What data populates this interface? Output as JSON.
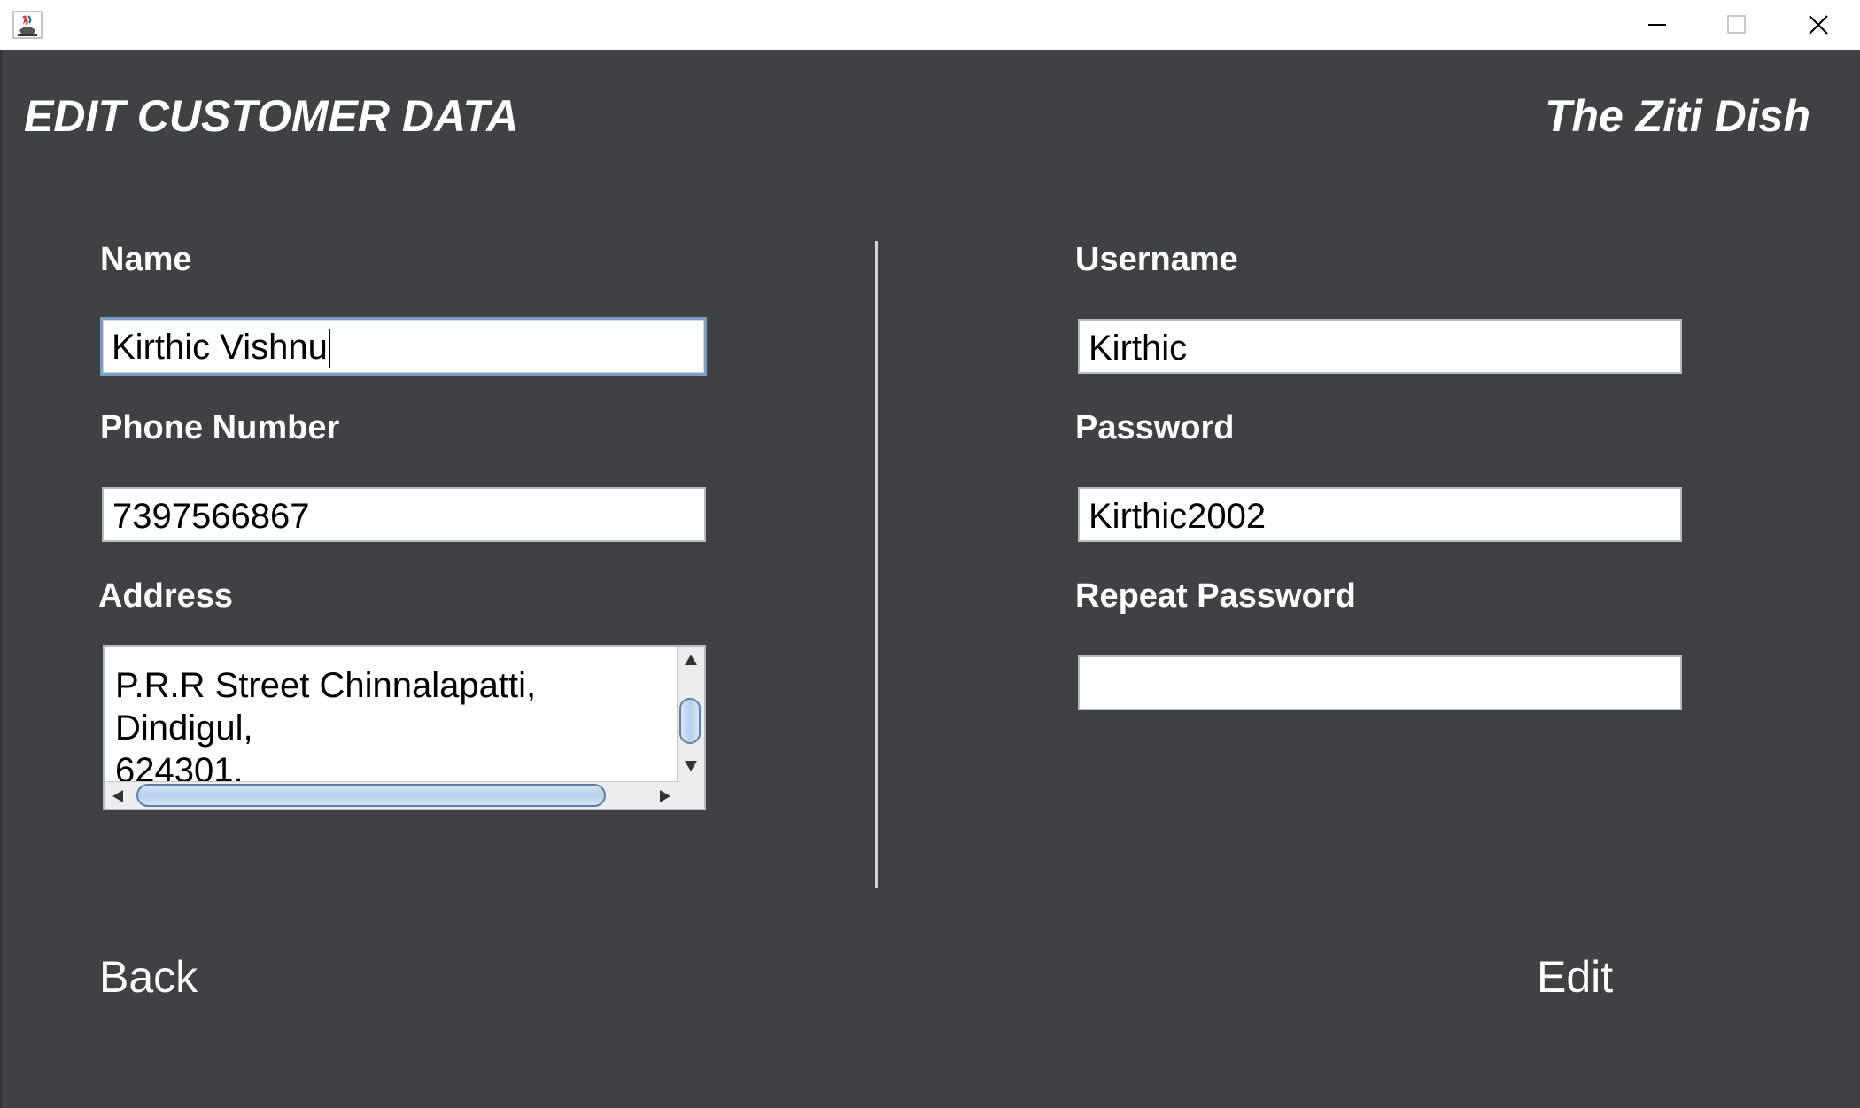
{
  "titlebar": {
    "app_icon": "java-app-icon",
    "minimize_icon": "minimize-icon",
    "maximize_icon": "maximize-icon",
    "close_icon": "close-icon"
  },
  "header": {
    "title": "EDIT CUSTOMER DATA",
    "brand": "The Ziti Dish"
  },
  "form": {
    "name_label": "Name",
    "name_value": "Kirthic Vishnu",
    "phone_label": "Phone Number",
    "phone_value": "7397566867",
    "address_label": "Address",
    "address_lines": [
      "P.R.R Street Chinnalapatti,",
      "Dindigul,",
      "624301."
    ],
    "username_label": "Username",
    "username_value": "Kirthic",
    "password_label": "Password",
    "password_value": "Kirthic2002",
    "repeat_password_label": "Repeat Password",
    "repeat_password_value": ""
  },
  "actions": {
    "back_label": "Back",
    "edit_label": "Edit"
  },
  "colors": {
    "background": "#3f4242",
    "text": "#ffffff",
    "focus_border": "#7f9dc4"
  }
}
